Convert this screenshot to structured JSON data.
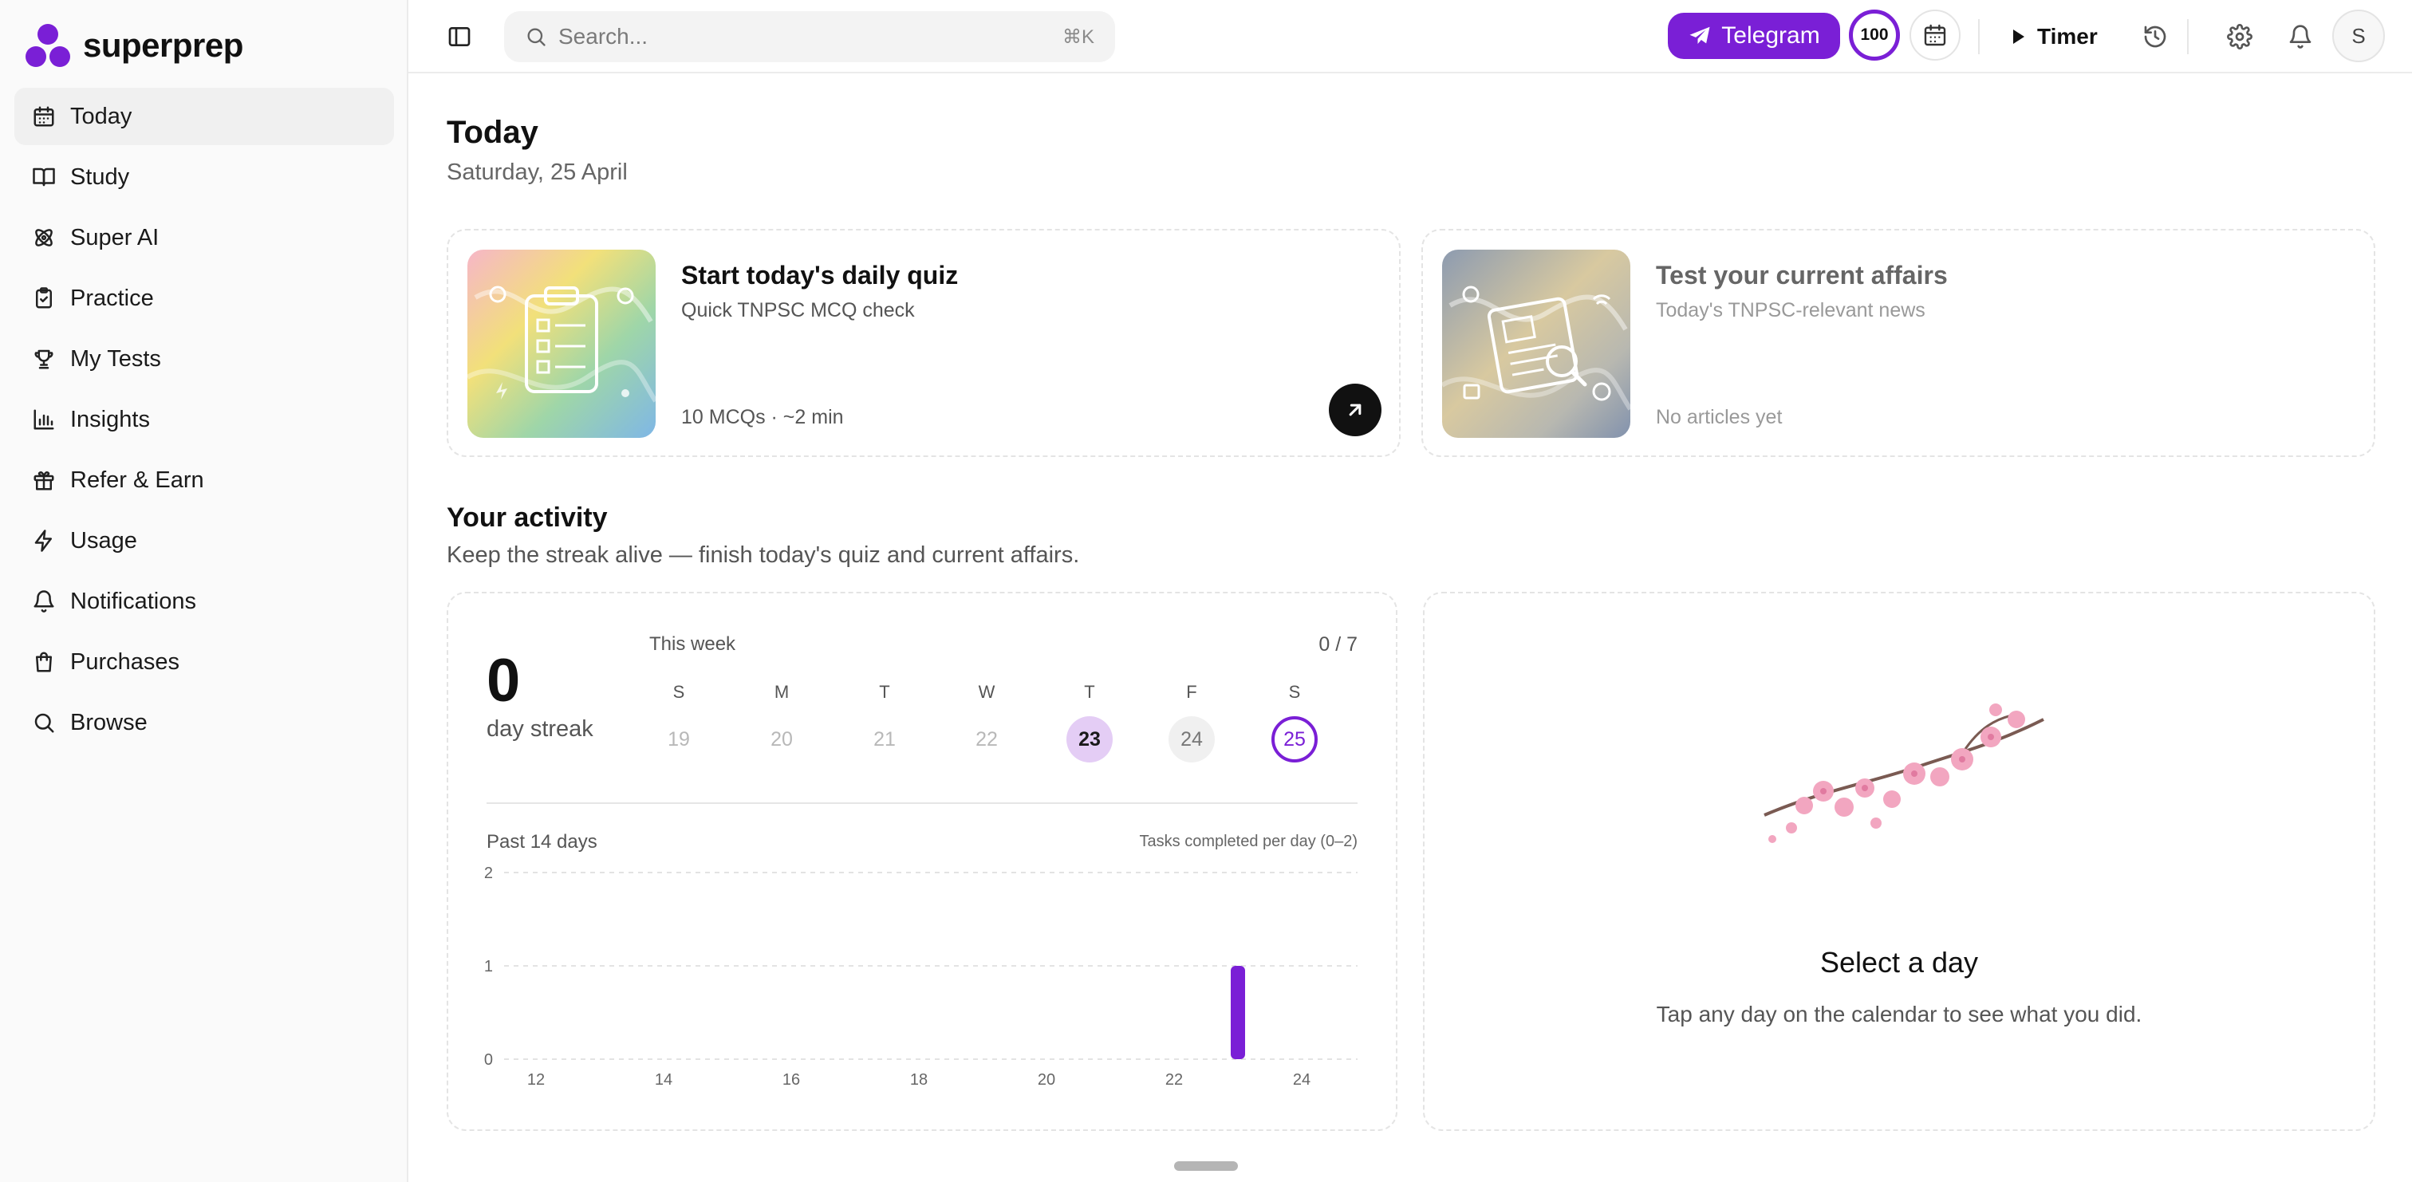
{
  "brand": {
    "name": "superprep",
    "color": "#7a1fd6"
  },
  "sidebar": {
    "items": [
      {
        "label": "Today",
        "icon": "calendar-icon",
        "active": true
      },
      {
        "label": "Study",
        "icon": "book-icon"
      },
      {
        "label": "Super AI",
        "icon": "atom-icon"
      },
      {
        "label": "Practice",
        "icon": "clipboard-icon"
      },
      {
        "label": "My Tests",
        "icon": "trophy-icon"
      },
      {
        "label": "Insights",
        "icon": "bar-chart-icon"
      },
      {
        "label": "Refer & Earn",
        "icon": "gift-icon"
      },
      {
        "label": "Usage",
        "icon": "lightning-icon"
      },
      {
        "label": "Notifications",
        "icon": "bell-icon"
      },
      {
        "label": "Purchases",
        "icon": "shopping-bag-icon"
      },
      {
        "label": "Browse",
        "icon": "search-icon"
      }
    ]
  },
  "topbar": {
    "search_placeholder": "Search...",
    "search_shortcut": "⌘K",
    "telegram_label": "Telegram",
    "points": "100",
    "timer_label": "Timer",
    "avatar_initial": "S"
  },
  "page": {
    "title": "Today",
    "date": "Saturday, 25 April"
  },
  "cards": {
    "quiz": {
      "title": "Start today's daily quiz",
      "subtitle": "Quick TNPSC MCQ check",
      "meta": "10 MCQs · ~2 min"
    },
    "current_affairs": {
      "title": "Test your current affairs",
      "subtitle": "Today's TNPSC-relevant news",
      "meta": "No articles yet"
    }
  },
  "activity": {
    "title": "Your activity",
    "subtitle": "Keep the streak alive — finish today's quiz and current affairs.",
    "streak_count": "0",
    "streak_label": "day streak",
    "week_label": "This week",
    "week_count": "0 / 7",
    "week_days": [
      {
        "letter": "S",
        "num": "19",
        "state": "future"
      },
      {
        "letter": "M",
        "num": "20",
        "state": "future"
      },
      {
        "letter": "T",
        "num": "21",
        "state": "future"
      },
      {
        "letter": "W",
        "num": "22",
        "state": "future"
      },
      {
        "letter": "T",
        "num": "23",
        "state": "done"
      },
      {
        "letter": "F",
        "num": "24",
        "state": "past"
      },
      {
        "letter": "S",
        "num": "25",
        "state": "today"
      }
    ],
    "chart_label": "Past 14 days",
    "chart_note": "Tasks completed per day (0–2)"
  },
  "chart_data": {
    "type": "bar",
    "x": [
      12,
      13,
      14,
      15,
      16,
      17,
      18,
      19,
      20,
      21,
      22,
      23,
      24,
      25
    ],
    "values": [
      0,
      0,
      0,
      0,
      0,
      0,
      0,
      0,
      0,
      0,
      0,
      1,
      0,
      0
    ],
    "x_ticks": [
      "12",
      "14",
      "16",
      "18",
      "20",
      "22",
      "24"
    ],
    "y_ticks": [
      "0",
      "1",
      "2"
    ],
    "ylim": [
      0,
      2
    ],
    "grid": true,
    "bar_color": "#7a1fd6"
  },
  "day_panel": {
    "title": "Select a day",
    "subtitle": "Tap any day on the calendar to see what you did."
  }
}
